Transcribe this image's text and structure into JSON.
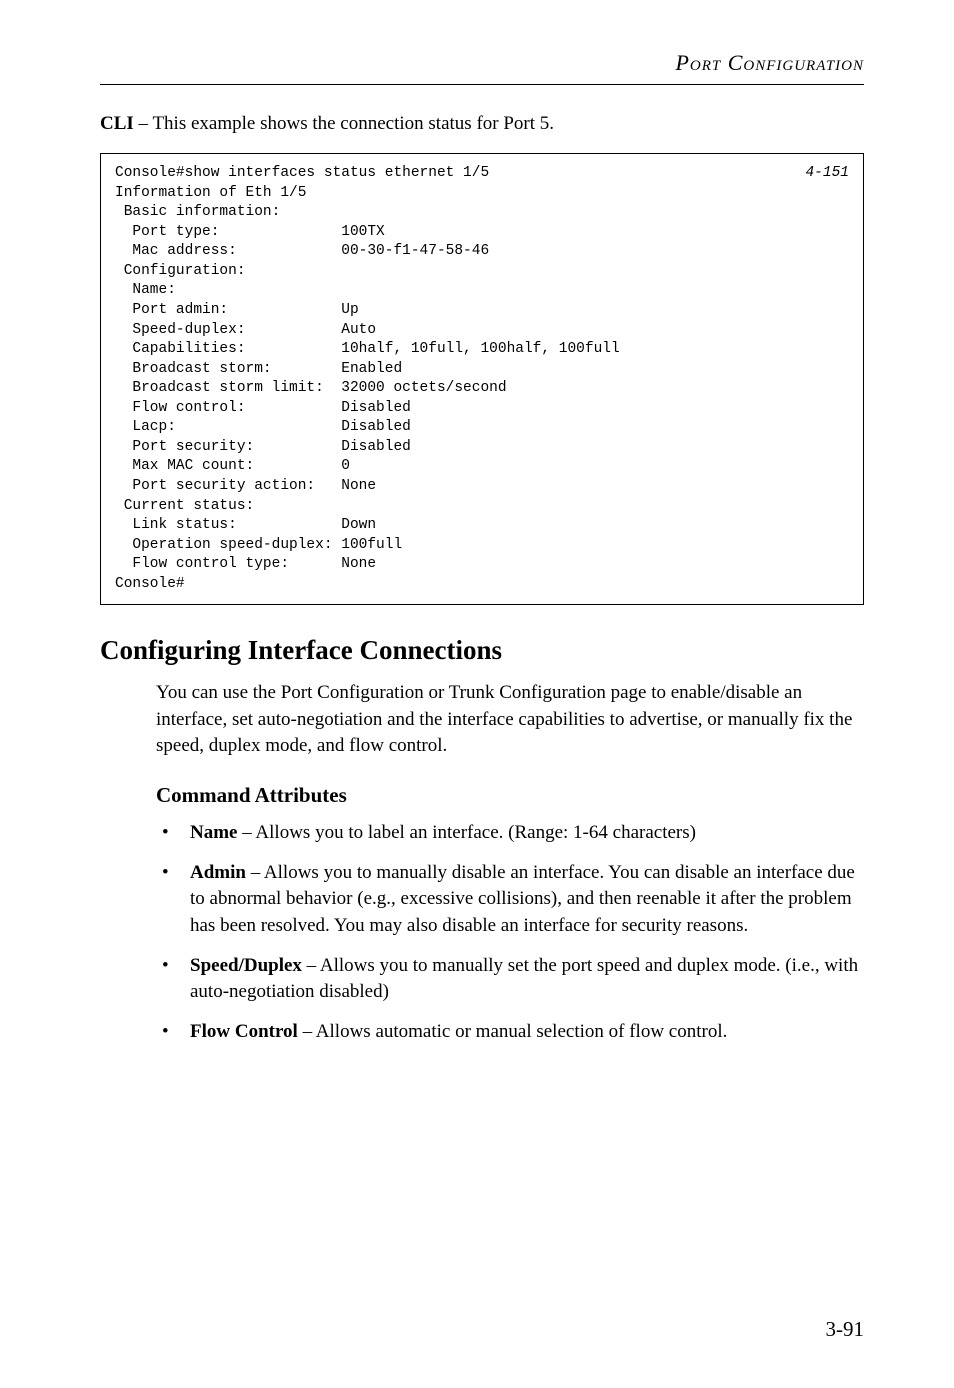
{
  "header": "Port Configuration",
  "intro_prefix": "CLI",
  "intro_text": " – This example shows the connection status for Port 5.",
  "console": {
    "first_line_cmd": "Console#show interfaces status ethernet 1/5",
    "first_line_ref": "4-151",
    "rest": "Information of Eth 1/5\n Basic information:\n  Port type:              100TX\n  Mac address:            00-30-f1-47-58-46\n Configuration:\n  Name:\n  Port admin:             Up\n  Speed-duplex:           Auto\n  Capabilities:           10half, 10full, 100half, 100full\n  Broadcast storm:        Enabled\n  Broadcast storm limit:  32000 octets/second\n  Flow control:           Disabled\n  Lacp:                   Disabled\n  Port security:          Disabled\n  Max MAC count:          0\n  Port security action:   None\n Current status:\n  Link status:            Down\n  Operation speed-duplex: 100full\n  Flow control type:      None\nConsole#"
  },
  "section_title": "Configuring Interface Connections",
  "section_body": "You can use the Port Configuration or Trunk Configuration page to enable/disable an interface, set auto-negotiation and the interface capabilities to advertise, or manually fix the speed, duplex mode, and flow control.",
  "subsection_title": "Command Attributes",
  "attrs": [
    {
      "name": "Name",
      "desc": " – Allows you to label an interface. (Range: 1-64 characters)"
    },
    {
      "name": "Admin",
      "desc": " – Allows you to manually disable an interface. You can disable an interface due to abnormal behavior (e.g., excessive collisions), and then reenable it after the problem has been resolved. You may also disable an interface for security reasons."
    },
    {
      "name": "Speed/Duplex",
      "desc": " – Allows you to manually set the port speed and duplex mode. (i.e., with auto-negotiation disabled)"
    },
    {
      "name": "Flow Control",
      "desc": " – Allows automatic or manual selection of flow control."
    }
  ],
  "page_number": "3-91"
}
